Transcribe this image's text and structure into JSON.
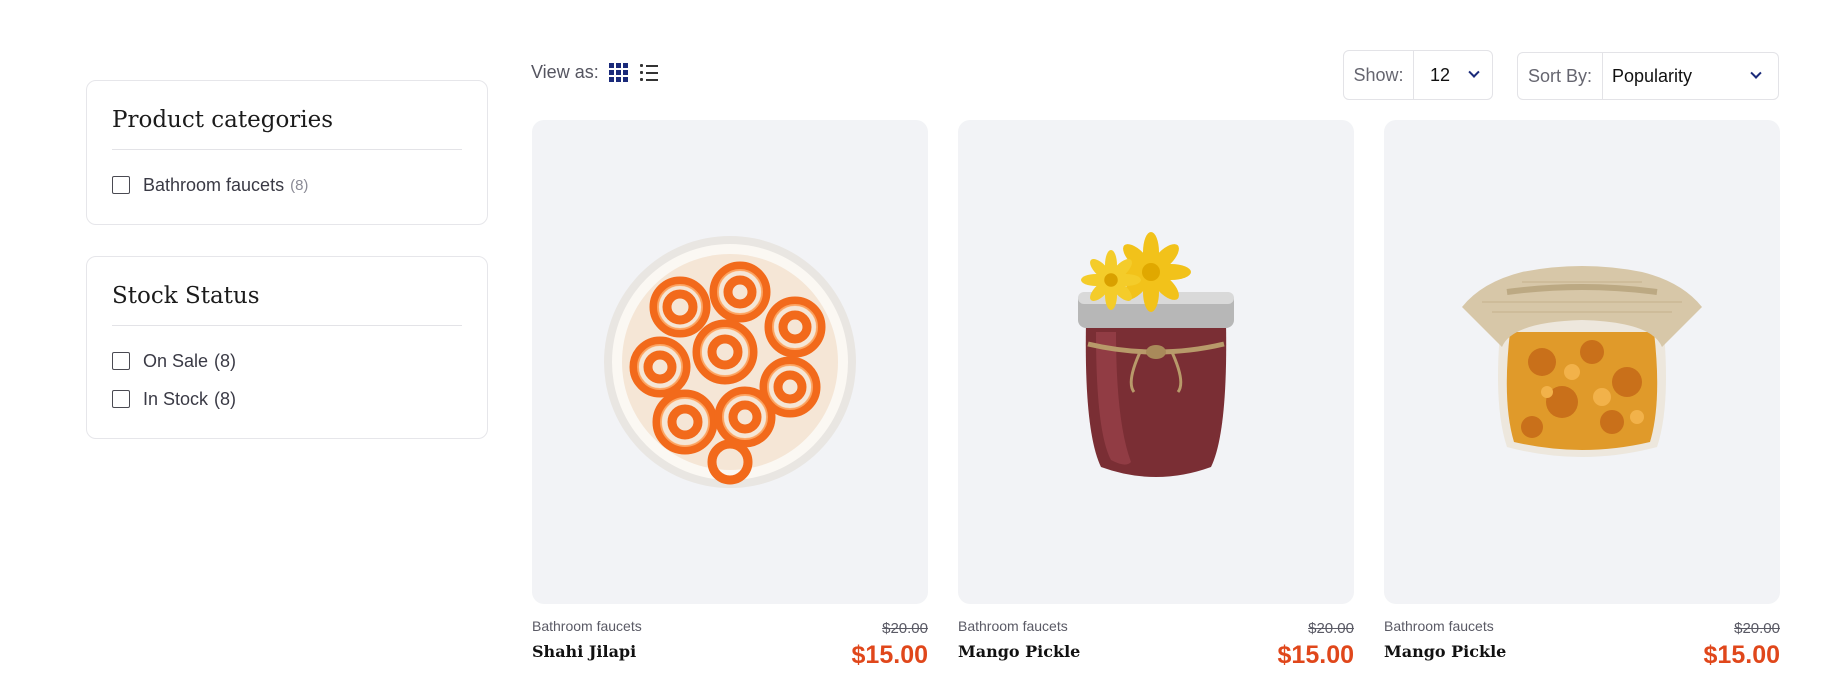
{
  "sidebar": {
    "categories": {
      "title": "Product categories",
      "items": [
        {
          "label": "Bathroom faucets",
          "count": "(8)"
        }
      ]
    },
    "stock": {
      "title": "Stock Status",
      "items": [
        {
          "label": "On Sale",
          "count": "(8)"
        },
        {
          "label": "In Stock",
          "count": "(8)"
        }
      ]
    }
  },
  "toolbar": {
    "view_as_label": "View as:",
    "show_label": "Show:",
    "show_value": "12",
    "sort_label": "Sort By:",
    "sort_value": "Popularity"
  },
  "products": [
    {
      "category": "Bathroom faucets",
      "name": "Shahi Jilapi",
      "old_price": "$20.00",
      "price": "$15.00",
      "image": "jalebi-bowl"
    },
    {
      "category": "Bathroom faucets",
      "name": "Mango Pickle",
      "old_price": "$20.00",
      "price": "$15.00",
      "image": "jam-jar-with-flowers"
    },
    {
      "category": "Bathroom faucets",
      "name": "Mango Pickle",
      "old_price": "$20.00",
      "price": "$15.00",
      "image": "pickle-jar-burlap"
    }
  ],
  "colors": {
    "accent": "#e0471b",
    "brand": "#1a2a7a",
    "card_bg": "#f2f3f6"
  }
}
